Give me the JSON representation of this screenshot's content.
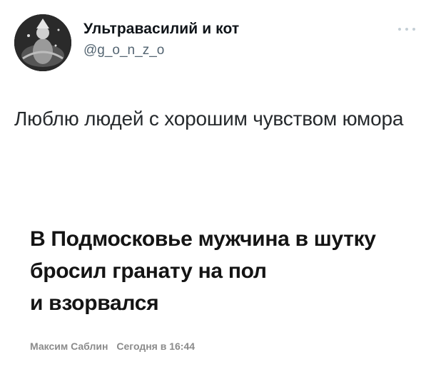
{
  "author": {
    "display_name": "Ультравасилий и кот",
    "handle": "@g_o_n_z_o"
  },
  "tweet": {
    "text": "Люблю людей с хорошим чувством юмора"
  },
  "embedded_news": {
    "headline": "В Подмосковье мужчина в шутку\nбросил гранату на пол\nи взорвался",
    "author": "Максим Саблин",
    "timestamp": "Сегодня в 16:44"
  },
  "icons": {
    "more": "more-horizontal-icon",
    "avatar": "avatar-image"
  }
}
